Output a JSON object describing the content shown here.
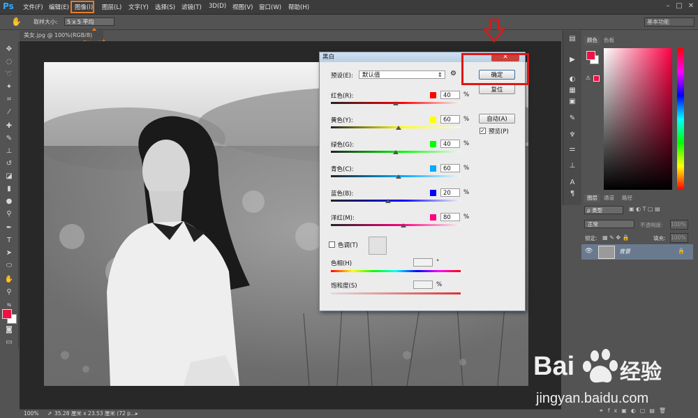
{
  "menubar": {
    "logo": "Ps",
    "items": [
      "文件(F)",
      "编辑(E)",
      "图像(I)",
      "图层(L)",
      "文字(Y)",
      "选择(S)",
      "滤镜(T)",
      "3D(D)",
      "视图(V)",
      "窗口(W)",
      "帮助(H)"
    ],
    "window_buttons": [
      "–",
      "□",
      "✕"
    ]
  },
  "options": {
    "sample_label": "取样大小:",
    "sample_value": "5 x 5 平均",
    "workspace": "基本功能"
  },
  "document": {
    "tab_label": "美女.jpg @ 100%(RGB/8)",
    "zoom": "100%",
    "doc_info": "35.28 厘米 x 23.53 厘米 (72 p..."
  },
  "dialog": {
    "title": "黑白",
    "preset_label": "预设(E):",
    "preset_value": "默认值",
    "ok": "确定",
    "reset": "复位",
    "auto": "自动(A)",
    "preview": "预览(P)",
    "preview_checked": true,
    "channels": [
      {
        "label": "红色(R):",
        "value": "40",
        "unit": "%",
        "color": "#ff0000",
        "level": 0.5
      },
      {
        "label": "黄色(Y):",
        "value": "60",
        "unit": "%",
        "color": "#ffff00",
        "level": 0.52
      },
      {
        "label": "绿色(G):",
        "value": "40",
        "unit": "%",
        "color": "#00ff00",
        "level": 0.5
      },
      {
        "label": "青色(C):",
        "value": "60",
        "unit": "%",
        "color": "#00aaff",
        "level": 0.52
      },
      {
        "label": "蓝色(B):",
        "value": "20",
        "unit": "%",
        "color": "#0000ff",
        "level": 0.44
      },
      {
        "label": "洋红(M):",
        "value": "80",
        "unit": "%",
        "color": "#ff0080",
        "level": 0.56
      }
    ],
    "tint_label": "色调(T)",
    "hue_label": "色相(H)",
    "hue_unit": "°",
    "saturation_label": "饱和度(S)",
    "saturation_unit": "%"
  },
  "panels": {
    "color_tabs": [
      "颜色",
      "色板"
    ],
    "layers_tabs": [
      "图层",
      "通道",
      "路径"
    ],
    "kind_filter": "ρ 类型",
    "blend_mode": "正常",
    "opacity_label": "不透明度:",
    "opacity_value": "100%",
    "lock_label": "锁定:",
    "fill_label": "填充:",
    "fill_value": "100%",
    "layer_name": "背景"
  },
  "watermark": {
    "brand_latin": "Bai",
    "brand_cn": "经验",
    "url": "jingyan.baidu.com"
  },
  "colors": {
    "foreground": "#ee1144",
    "background": "#ffffff",
    "annotation_orange": "#f07a22",
    "annotation_red": "#e01515"
  }
}
